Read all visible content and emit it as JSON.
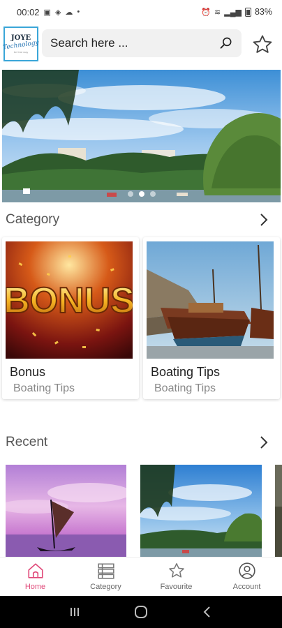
{
  "status_bar": {
    "time": "00:02",
    "battery": "83%"
  },
  "header": {
    "logo_line1": "JOYE",
    "logo_line2": "Technology",
    "logo_line3": "be that way",
    "search_placeholder": "Search here ...",
    "search_icon": "search-icon",
    "favourite_icon": "star-outline-icon"
  },
  "banner": {
    "image": "lake-with-willow-trees",
    "slide_count": 3,
    "active_slide": 2
  },
  "category_section": {
    "title": "Category",
    "more_icon": "chevron-right-icon",
    "cards": [
      {
        "title": "Bonus",
        "subtitle": "Boating Tips",
        "image_text": "BONUS"
      },
      {
        "title": "Boating Tips",
        "subtitle": "Boating Tips",
        "image": "wooden-boats"
      }
    ]
  },
  "recent_section": {
    "title": "Recent",
    "more_icon": "chevron-right-icon",
    "items": [
      {
        "image": "sailboat-purple-sunset"
      },
      {
        "image": "lake-with-willow-trees"
      },
      {
        "image": "partial-third-item"
      }
    ]
  },
  "bottom_nav": {
    "items": [
      {
        "label": "Home",
        "icon": "home-icon",
        "active": true
      },
      {
        "label": "Category",
        "icon": "list-icon",
        "active": false
      },
      {
        "label": "Favourite",
        "icon": "star-outline-icon",
        "active": false
      },
      {
        "label": "Account",
        "icon": "account-circle-icon",
        "active": false
      }
    ],
    "active_color": "#e04a7a"
  },
  "system_nav": {
    "buttons": [
      "recents-icon",
      "home-circle-icon",
      "back-icon"
    ]
  }
}
